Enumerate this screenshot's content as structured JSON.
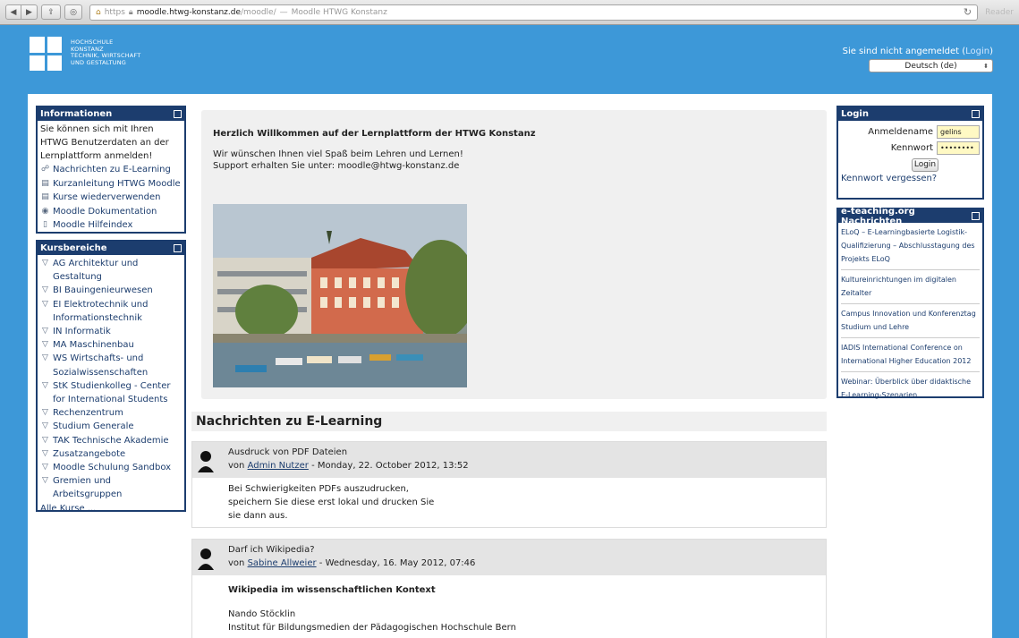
{
  "browser": {
    "url_protocol": "https",
    "url_host": "moodle.htwg-konstanz.de",
    "url_path": "/moodle/",
    "url_separator": "—",
    "page_title": "Moodle HTWG Konstanz",
    "reader_label": "Reader"
  },
  "header": {
    "logo_lines": [
      "HOCHSCHULE",
      "KONSTANZ",
      "TECHNIK, WIRTSCHAFT",
      "UND GESTALTUNG"
    ],
    "login_status": "Sie sind nicht angemeldet",
    "login_link": "Login",
    "language": "Deutsch (de)"
  },
  "informationen": {
    "title": "Informationen",
    "intro": "Sie können sich mit Ihren HTWG Benutzerdaten an der Lernplattform anmelden!",
    "links": [
      {
        "label": "Nachrichten zu E-Learning",
        "icon": "forum-icon"
      },
      {
        "label": "Kurzanleitung HTWG Moodle",
        "icon": "book-icon"
      },
      {
        "label": "Kurse wiederverwenden",
        "icon": "book-icon"
      },
      {
        "label": "Moodle Dokumentation",
        "icon": "moodle-icon"
      },
      {
        "label": "Moodle Hilfeindex",
        "icon": "page-icon"
      }
    ]
  },
  "kursbereiche": {
    "title": "Kursbereiche",
    "items": [
      "AG Architektur und Gestaltung",
      "BI Bauingenieurwesen",
      "EI Elektrotechnik und Informationstechnik",
      "IN Informatik",
      "MA Maschinenbau",
      "WS Wirtschafts- und Sozialwissenschaften",
      "StK Studienkolleg - Center for International Students",
      "Rechenzentrum",
      "Studium Generale",
      "TAK Technische Akademie",
      "Zusatzangebote",
      "Moodle Schulung Sandbox",
      "Gremien und Arbeitsgruppen"
    ],
    "all_courses": "Alle Kurse ..."
  },
  "welcome": {
    "heading": "Herzlich Willkommen auf der Lernplattform der HTWG Konstanz",
    "line1": "Wir wünschen Ihnen viel Spaß beim Lehren und Lernen!",
    "line2": "Support erhalten Sie unter: moodle@htwg-konstanz.de"
  },
  "news": {
    "title": "Nachrichten zu E-Learning",
    "posts": [
      {
        "subject": "Ausdruck von PDF Dateien",
        "by_prefix": "von",
        "author": "Admin Nutzer",
        "date": "- Monday, 22. October 2012, 13:52",
        "body": [
          "Bei Schwierigkeiten PDFs auszudrucken,",
          "speichern Sie diese erst lokal und drucken Sie",
          "sie dann aus."
        ]
      },
      {
        "subject": "Darf ich Wikipedia?",
        "by_prefix": "von",
        "author": "Sabine Allweier",
        "date": "- Wednesday, 16. May 2012, 07:46",
        "heading": "Wikipedia im wissenschaftlichen Kontext",
        "body": [
          "Nando Stöcklin",
          "Institut für Bildungsmedien der Pädagogischen Hochschule Bern"
        ]
      }
    ]
  },
  "login": {
    "title": "Login",
    "username_label": "Anmeldename",
    "username_value": "gelins",
    "password_label": "Kennwort",
    "password_value": "••••••••",
    "button": "Login",
    "forgot": "Kennwort vergessen?"
  },
  "eteaching": {
    "title": "e-teaching.org Nachrichten",
    "items": [
      "ELoQ – E-Learningbasierte Logistik-Qualifizierung – Abschlusstagung des Projekts ELoQ",
      "Kultureinrichtungen im digitalen Zeitalter",
      "Campus Innovation und Konferenztag Studium und Lehre",
      "IADIS International Conference on International Higher Education 2012",
      "Webinar: Überblick über didaktische E-Learning-Szenarien"
    ]
  }
}
